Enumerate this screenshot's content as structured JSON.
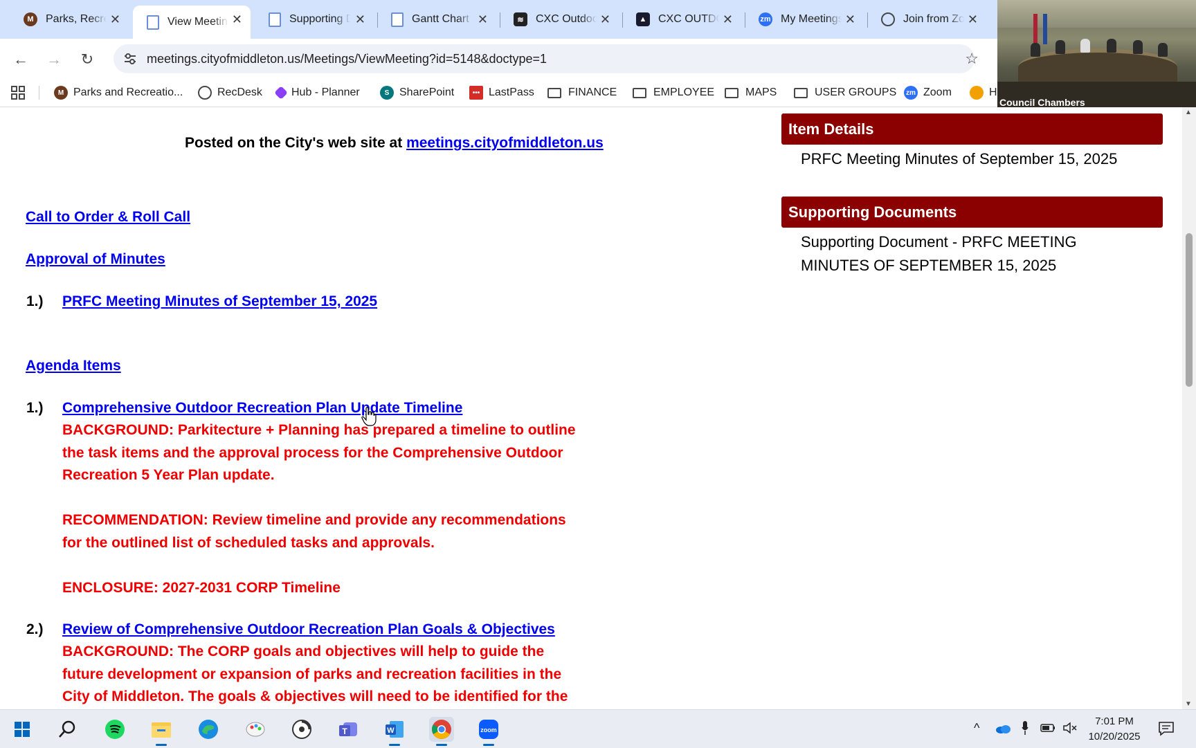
{
  "tabs": [
    {
      "title": "Parks, Recre",
      "icon": "parks-logo-icon"
    },
    {
      "title": "View Meeting",
      "icon": "document-icon",
      "active": true
    },
    {
      "title": "Supporting Document",
      "icon": "document-icon"
    },
    {
      "title": "Gantt Chart",
      "icon": "document-icon"
    },
    {
      "title": "CXC Outdoor",
      "icon": "cxc-logo-icon"
    },
    {
      "title": "CXC OUTDOOR",
      "icon": "adobe-icon"
    },
    {
      "title": "My Meetings",
      "icon": "zoom-icon"
    },
    {
      "title": "Join from Zoom",
      "icon": "globe-icon"
    }
  ],
  "toolbar": {
    "url": "meetings.cityofmiddleton.us/Meetings/ViewMeeting?id=5148&doctype=1"
  },
  "bookmarks": [
    {
      "label": "Parks and Recreatio...",
      "icon": "parks-logo-icon"
    },
    {
      "label": "RecDesk",
      "icon": "globe-icon"
    },
    {
      "label": "Hub - Planner",
      "icon": "hub-planner-icon"
    },
    {
      "label": "SharePoint",
      "icon": "sharepoint-icon"
    },
    {
      "label": "LastPass",
      "icon": "lastpass-icon"
    },
    {
      "label": "FINANCE",
      "icon": "folder-icon"
    },
    {
      "label": "EMPLOYEE",
      "icon": "folder-icon"
    },
    {
      "label": "MAPS",
      "icon": "folder-icon"
    },
    {
      "label": "USER GROUPS",
      "icon": "folder-icon"
    },
    {
      "label": "Zoom",
      "icon": "zoom-icon"
    },
    {
      "label": "H",
      "icon": "app-icon"
    }
  ],
  "video": {
    "caption": "Council Chambers"
  },
  "page": {
    "posted_prefix": "Posted on the City's web site at ",
    "posted_link": "meetings.cityofmiddleton.us",
    "call_to_order": "Call to Order & Roll Call",
    "approval_of_minutes": "Approval of Minutes",
    "minutes_item": {
      "num": "1.)",
      "title": "PRFC Meeting Minutes of September 15, 2025"
    },
    "agenda_items": "Agenda Items",
    "items": [
      {
        "num": "1.)",
        "title": "Comprehensive Outdoor Recreation Plan Update Timeline",
        "lines": [
          "BACKGROUND: Parkitecture + Planning has prepared a timeline to outline",
          "the task items and the approval process for the Comprehensive Outdoor",
          "Recreation 5 Year Plan update.",
          "",
          "RECOMMENDATION: Review timeline and provide any recommendations",
          "for the outlined list of scheduled tasks and approvals.",
          "",
          "ENCLOSURE: 2027-2031 CORP Timeline"
        ]
      },
      {
        "num": "2.)",
        "title": "Review of Comprehensive Outdoor Recreation Plan Goals & Objectives",
        "lines": [
          "BACKGROUND: The CORP goals and objectives will help to guide the",
          "future development or expansion of parks and recreation facilities in the",
          "City of Middleton. The goals & objectives will need to be identified for the"
        ]
      }
    ]
  },
  "sidebar": {
    "item_details_header": "Item Details",
    "item_details_text": "PRFC Meeting Minutes of September 15, 2025",
    "supporting_header": "Supporting Documents",
    "supporting_line1": "Supporting Document - PRFC MEETING",
    "supporting_line2": "MINUTES OF SEPTEMBER 15, 2025"
  },
  "taskbar": {
    "apps": [
      "windows-start-icon",
      "search-icon",
      "spotify-icon",
      "file-explorer-icon",
      "edge-icon",
      "paint-icon",
      "arcgis-icon",
      "teams-icon",
      "word-icon",
      "chrome-icon",
      "zoom-icon"
    ],
    "time": "7:01 PM",
    "date": "10/20/2025"
  },
  "colors": {
    "tabstrip": "#d3e3fd",
    "section_header": "#8b0000",
    "link": "#0000ee",
    "agenda_text": "#ee0000"
  }
}
